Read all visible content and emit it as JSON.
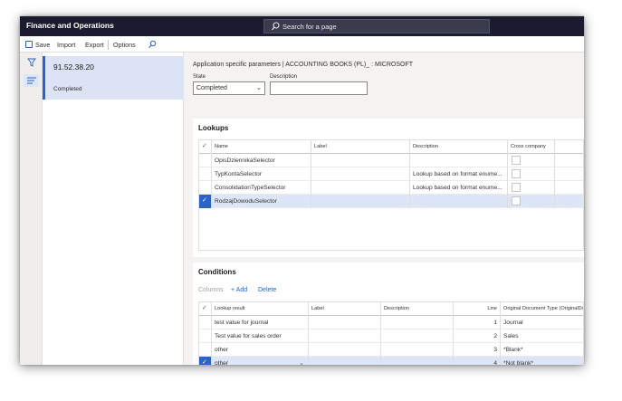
{
  "topbar": {
    "title": "Finance and Operations",
    "search_placeholder": "Search for a page"
  },
  "toolbar": {
    "save": "Save",
    "import": "Import",
    "export": "Export",
    "options": "Options"
  },
  "list": {
    "title": "91.52.38.20",
    "status": "Completed"
  },
  "main": {
    "breadcrumb": "Application specific parameters  |  ACCOUNTING BOOKS (PL)_ : MICROSOFT",
    "state_label": "State",
    "state_value": "Completed",
    "description_label": "Description",
    "description_value": ""
  },
  "lookups": {
    "title": "Lookups",
    "columns": [
      "Name",
      "Label",
      "Description",
      "Cross company"
    ],
    "rows": [
      {
        "name": "OpisDziennikaSelector",
        "label": "",
        "description": "",
        "selected": false
      },
      {
        "name": "TypKontaSelector",
        "label": "",
        "description": "Lookup based on format enume...",
        "selected": false
      },
      {
        "name": "ConsolidationTypeSelector",
        "label": "",
        "description": "Lookup based on format enume...",
        "selected": false
      },
      {
        "name": "RodzajDowoduSelector",
        "label": "",
        "description": "",
        "selected": true
      }
    ]
  },
  "conditions": {
    "title": "Conditions",
    "actions": {
      "columns": "Columns",
      "add": "+ Add",
      "delete": "Delete"
    },
    "columns": [
      "Lookup result",
      "Label",
      "Description",
      "Line",
      "Original Document Type (OriginalDo..."
    ],
    "rows": [
      {
        "result": "test value for journal",
        "label": "",
        "description": "",
        "line": "1",
        "doc_type": "Journal",
        "selected": false
      },
      {
        "result": "Test value for sales order",
        "label": "",
        "description": "",
        "line": "2",
        "doc_type": "Sales",
        "selected": false
      },
      {
        "result": "other",
        "label": "",
        "description": "",
        "line": "3",
        "doc_type": "*Blank*",
        "selected": false
      },
      {
        "result": "other",
        "label": "",
        "description": "",
        "line": "4",
        "doc_type": "*Not blank*",
        "selected": true
      }
    ]
  },
  "colors": {
    "accent": "#2b63c6",
    "topbar": "#1b1b2f",
    "selection": "#dde6f6"
  },
  "icons": [
    "search-icon",
    "save-icon",
    "filter-icon",
    "list-icon",
    "checkmark-icon",
    "chevron-down-icon"
  ]
}
